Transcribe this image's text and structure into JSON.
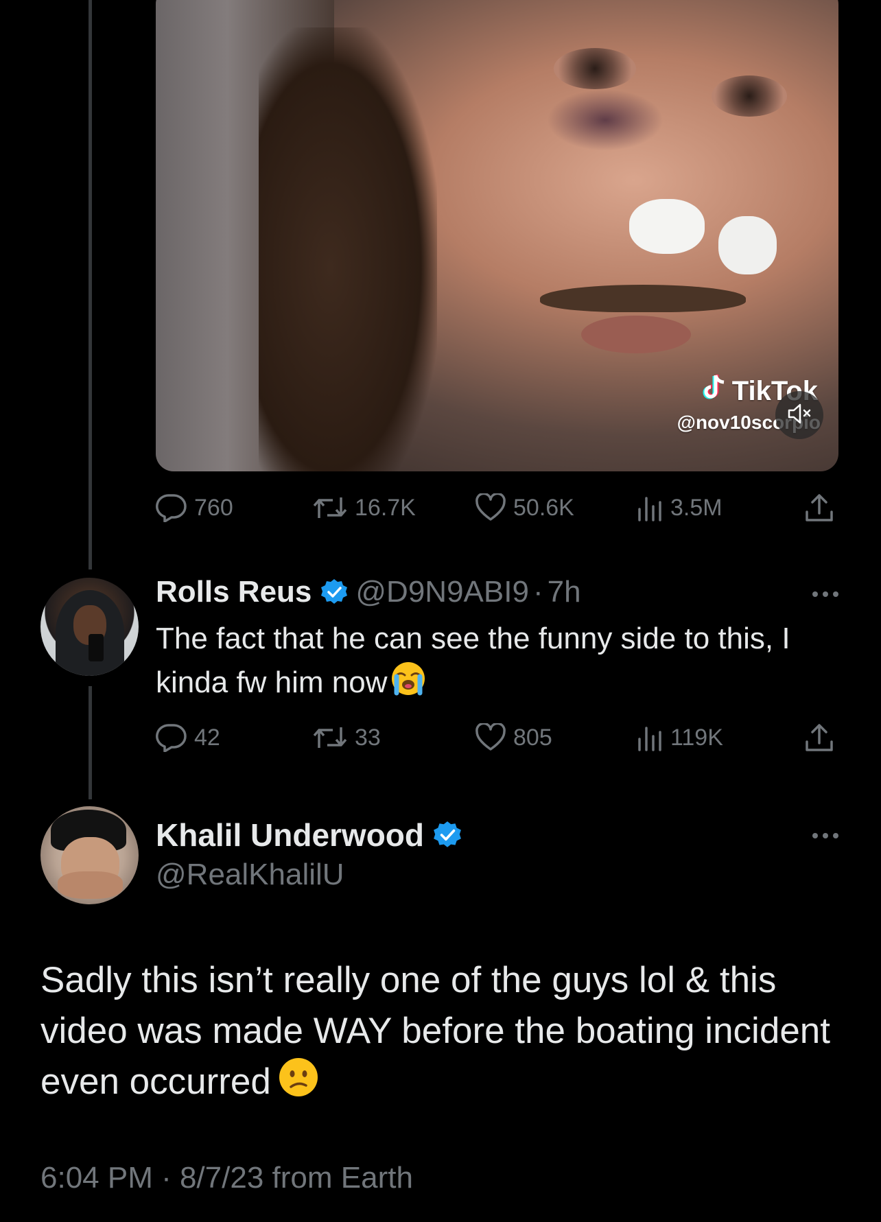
{
  "media": {
    "watermark_brand": "TikTok",
    "watermark_handle": "@nov10scorpio"
  },
  "media_tweet_stats": {
    "replies": "760",
    "retweets": "16.7K",
    "likes": "50.6K",
    "views": "3.5M"
  },
  "reply": {
    "name": "Rolls Reus",
    "handle": "@D9N9ABI9",
    "separator": "·",
    "time": "7h",
    "text": "The fact that he can see the funny side to this, I kinda fw him now",
    "stats": {
      "replies": "42",
      "retweets": "33",
      "likes": "805",
      "views": "119K"
    }
  },
  "main_tweet": {
    "name": "Khalil Underwood",
    "handle": "@RealKhalilU",
    "text": "Sadly this isn’t really one of the guys lol & this video was made WAY before the boating incident even occurred",
    "timestamp": "6:04 PM · 8/7/23 from Earth"
  },
  "colors": {
    "background": "#000000",
    "text_primary": "#e7e9ea",
    "text_secondary": "#71767b",
    "verified_blue": "#1d9bf0",
    "thread_line": "#333639"
  }
}
